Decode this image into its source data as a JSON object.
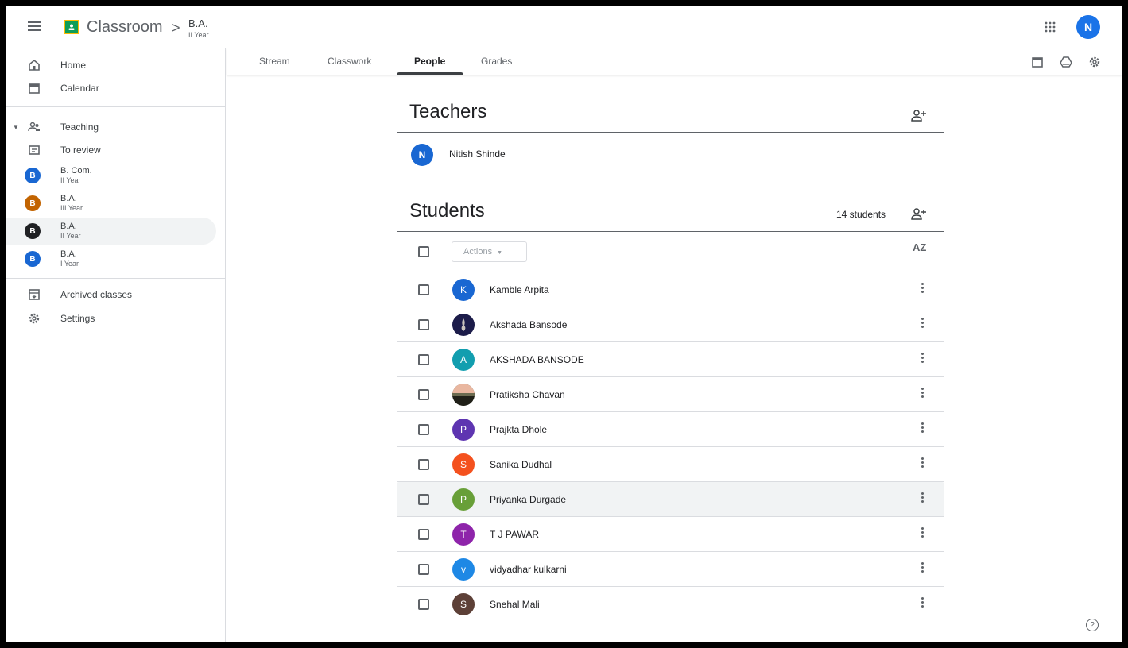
{
  "header": {
    "brand": "Classroom",
    "crumb_arrow": ">",
    "class_title": "B.A.",
    "class_subtitle": "II Year",
    "user_initial": "N"
  },
  "sidebar": {
    "home": "Home",
    "calendar": "Calendar",
    "teaching": "Teaching",
    "to_review": "To review",
    "classes": [
      {
        "initial": "B",
        "title": "B. Com.",
        "subtitle": "II Year",
        "color": "#1967d2"
      },
      {
        "initial": "B",
        "title": "B.A.",
        "subtitle": "III Year",
        "color": "#c26401"
      },
      {
        "initial": "B",
        "title": "B.A.",
        "subtitle": "II Year",
        "color": "#202124"
      },
      {
        "initial": "B",
        "title": "B.A.",
        "subtitle": "I Year",
        "color": "#1967d2"
      }
    ],
    "archived": "Archived classes",
    "settings": "Settings"
  },
  "tabs": {
    "stream": "Stream",
    "classwork": "Classwork",
    "people": "People",
    "grades": "Grades"
  },
  "teachers": {
    "title": "Teachers",
    "list": [
      {
        "initial": "N",
        "name": "Nitish Shinde"
      }
    ]
  },
  "students": {
    "title": "Students",
    "count": "14 students",
    "actions_label": "Actions",
    "sort_label": "AZ",
    "list": [
      {
        "initial": "K",
        "name": "Kamble Arpita",
        "color": "#1967d2"
      },
      {
        "initial": "",
        "name": "Akshada Bansode",
        "color": "#1c1c4a"
      },
      {
        "initial": "A",
        "name": "AKSHADA BANSODE",
        "color": "#129eaf"
      },
      {
        "initial": "",
        "name": "Pratiksha Chavan",
        "color": "#4a4a3a"
      },
      {
        "initial": "P",
        "name": "Prajkta Dhole",
        "color": "#5e35b1"
      },
      {
        "initial": "S",
        "name": "Sanika Dudhal",
        "color": "#f4511e"
      },
      {
        "initial": "P",
        "name": "Priyanka Durgade",
        "color": "#689f38"
      },
      {
        "initial": "T",
        "name": "T J PAWAR",
        "color": "#8e24aa"
      },
      {
        "initial": "v",
        "name": "vidyadhar kulkarni",
        "color": "#1e88e5"
      },
      {
        "initial": "S",
        "name": "Snehal Mali",
        "color": "#5d4037"
      }
    ]
  },
  "colors": {
    "accent": "#1a73e8",
    "text": "#3c4043",
    "divider": "#dadce0",
    "hover": "#f1f3f4"
  }
}
